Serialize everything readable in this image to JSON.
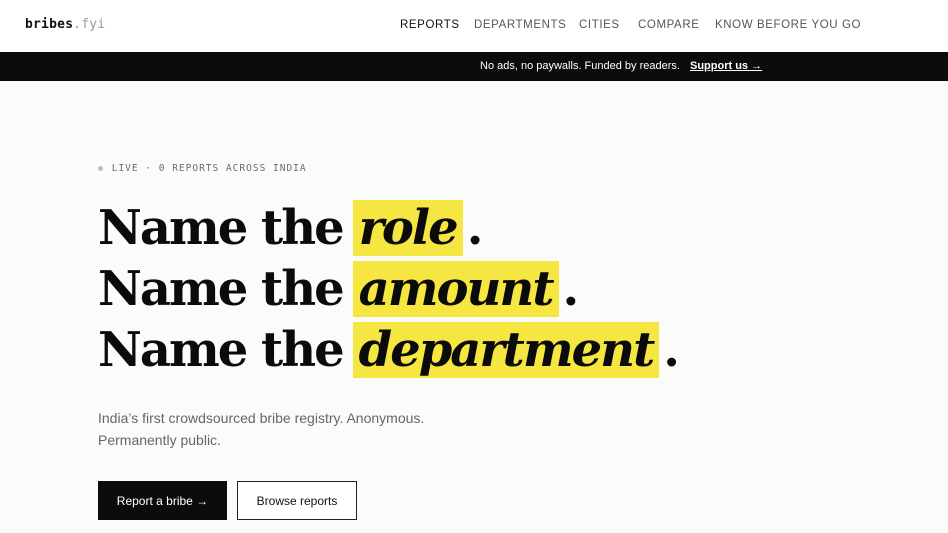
{
  "logo": {
    "name": "bribes",
    "tld": ".fyi"
  },
  "nav": {
    "items": [
      {
        "label": "REPORTS",
        "active": true
      },
      {
        "label": "DEPARTMENTS",
        "active": false
      },
      {
        "label": "CITIES",
        "active": false
      },
      {
        "label": "COMPARE",
        "active": false
      },
      {
        "label": "KNOW BEFORE YOU GO",
        "active": false
      }
    ]
  },
  "banner": {
    "message": "No ads, no paywalls. Funded by readers.",
    "link": "Support us →"
  },
  "hero": {
    "status": "LIVE · 0 REPORTS ACROSS INDIA",
    "lines": [
      {
        "prefix": "Name the",
        "highlight": "role",
        "suffix": "."
      },
      {
        "prefix": "Name the",
        "highlight": "amount",
        "suffix": "."
      },
      {
        "prefix": "Name the",
        "highlight": "department",
        "suffix": "."
      }
    ],
    "subtitle": "India’s first crowdsourced bribe registry. Anonymous. Permanently public.",
    "primary_cta": "Report a bribe →",
    "secondary_cta": "Browse reports"
  },
  "colors": {
    "highlight": "#f5e642",
    "dark": "#0c0c0c",
    "background": "#fbfbfa"
  }
}
